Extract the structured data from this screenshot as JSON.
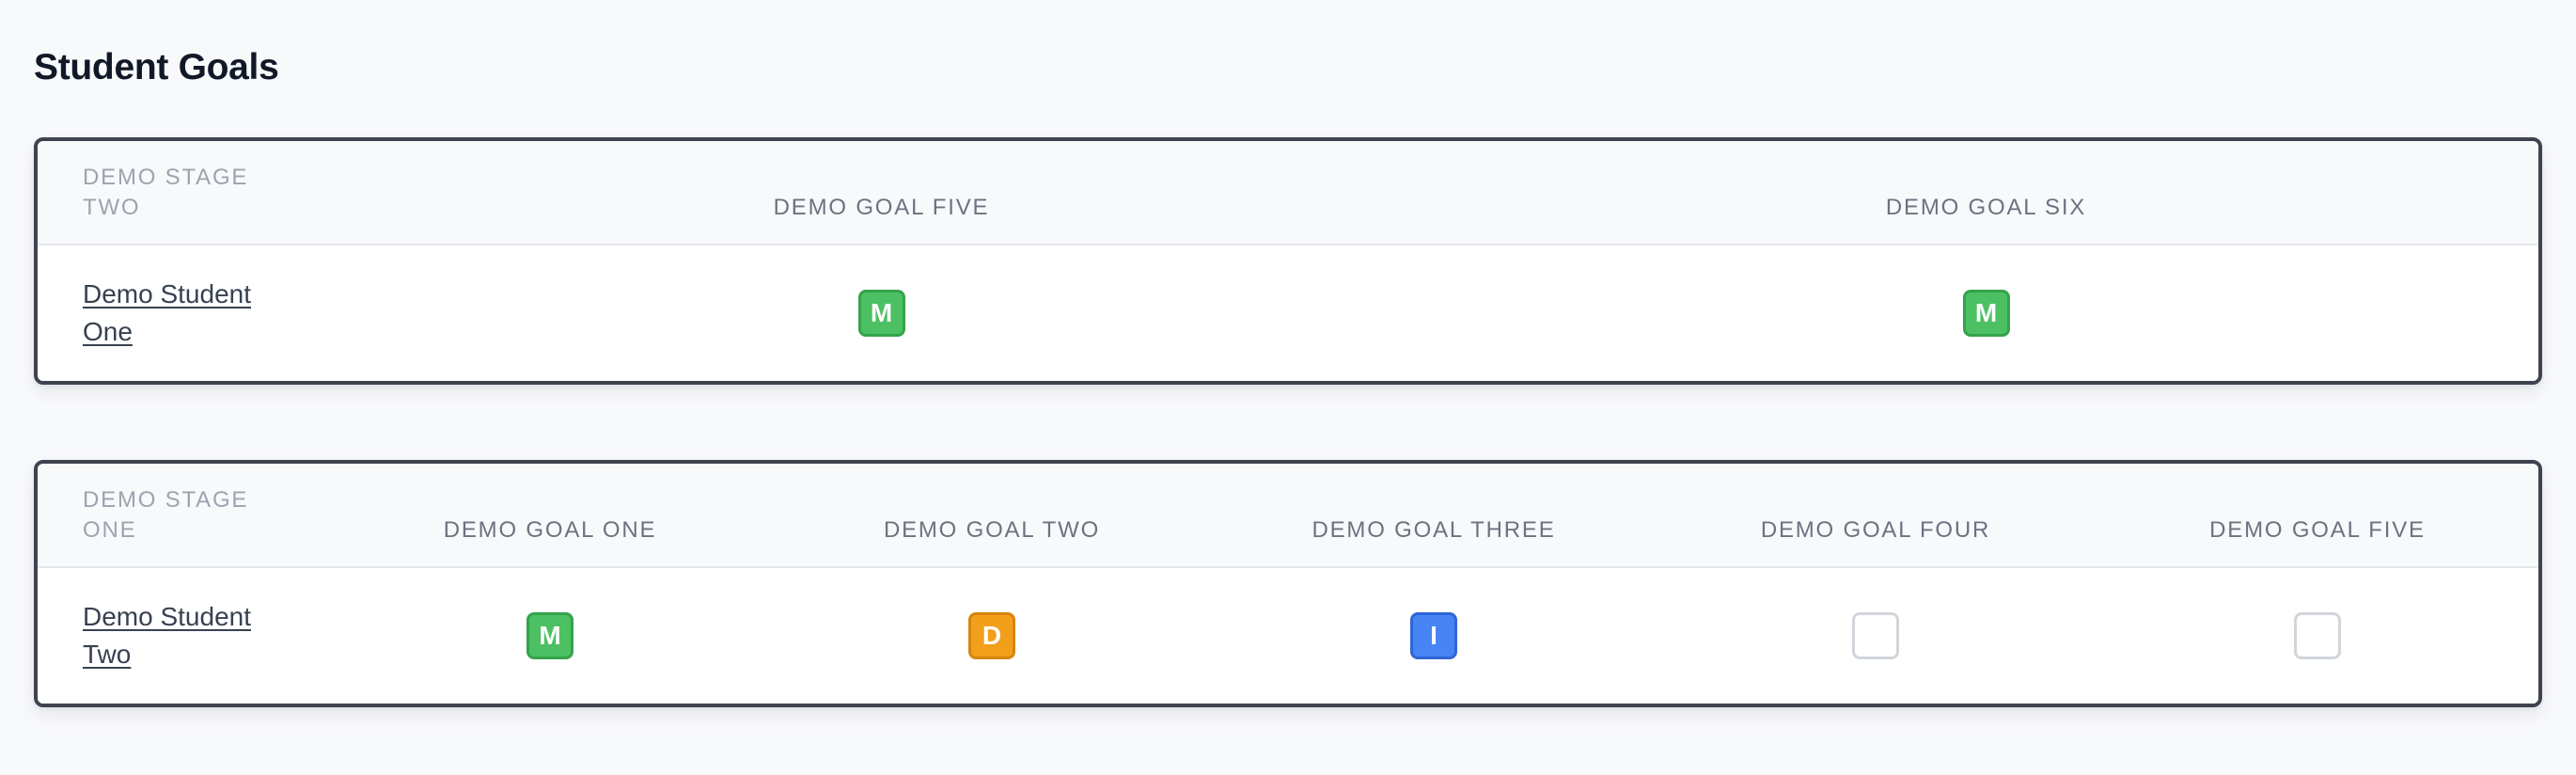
{
  "page_title": "Student Goals",
  "cards": [
    {
      "stage": "DEMO STAGE TWO",
      "goals": [
        "DEMO GOAL FIVE",
        "DEMO GOAL SIX"
      ],
      "student": "Demo Student One",
      "statuses": [
        "M",
        "M"
      ],
      "status_kinds": [
        "mastered",
        "mastered"
      ]
    },
    {
      "stage": "DEMO STAGE ONE",
      "goals": [
        "DEMO GOAL ONE",
        "DEMO GOAL TWO",
        "DEMO GOAL THREE",
        "DEMO GOAL FOUR",
        "DEMO GOAL FIVE"
      ],
      "student": "Demo Student Two",
      "statuses": [
        "M",
        "D",
        "I",
        "",
        ""
      ],
      "status_kinds": [
        "mastered",
        "developing",
        "introduced",
        "empty",
        "empty"
      ]
    }
  ],
  "colors": {
    "mastered": "#4cc063",
    "developing": "#f29f1b",
    "introduced": "#4784f4",
    "card_border": "#3f4350"
  }
}
